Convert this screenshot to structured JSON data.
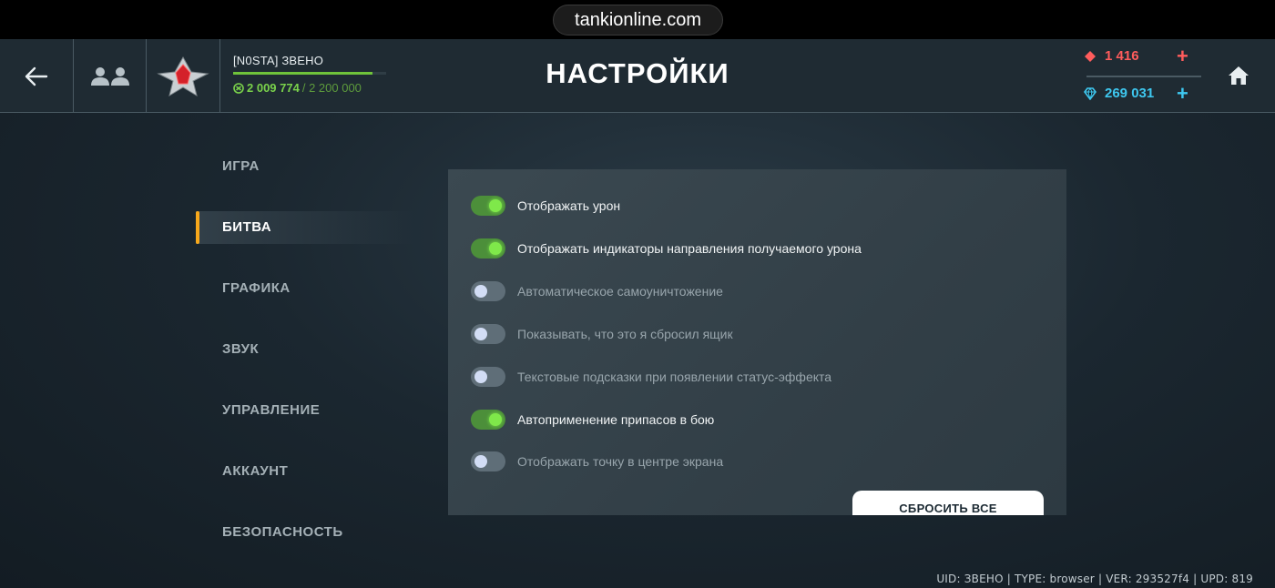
{
  "browser": {
    "url": "tankionline.com"
  },
  "header": {
    "title": "НАСТРОЙКИ",
    "player": {
      "name": "[N0STA] ЗВЕНО",
      "xp_current": "2 009 774",
      "xp_max": "/ 2 200 000",
      "xp_progress": 0.913
    },
    "currency": {
      "rubies": "1 416",
      "crystals": "269 031",
      "plus": "+"
    },
    "colors": {
      "accent": "#f7a81b",
      "xp": "#6fc33a",
      "ruby": "#ff5c5c",
      "crystal": "#3ec8f0"
    }
  },
  "sidebar": {
    "items": [
      {
        "label": "ИГРА",
        "active": false
      },
      {
        "label": "БИТВА",
        "active": true
      },
      {
        "label": "ГРАФИКА",
        "active": false
      },
      {
        "label": "ЗВУК",
        "active": false
      },
      {
        "label": "УПРАВЛЕНИЕ",
        "active": false
      },
      {
        "label": "АККАУНТ",
        "active": false
      },
      {
        "label": "БЕЗОПАСНОСТЬ",
        "active": false
      }
    ]
  },
  "settings": {
    "options": [
      {
        "label": "Отображать урон",
        "enabled": true
      },
      {
        "label": "Отображать индикаторы направления получаемого урона",
        "enabled": true
      },
      {
        "label": "Автоматическое самоуничтожение",
        "enabled": false
      },
      {
        "label": "Показывать, что это я сбросил ящик",
        "enabled": false
      },
      {
        "label": "Текстовые подсказки при появлении статус-эффекта",
        "enabled": false
      },
      {
        "label": "Автоприменение припасов в бою",
        "enabled": true
      },
      {
        "label": "Отображать точку в центре экрана",
        "enabled": false
      }
    ],
    "reset_label": "СБРОСИТЬ ВСЕ"
  },
  "footer": {
    "build_info": "UID: ЗВЕНО | TYPE: browser | VER: 293527f4 | UPD: 819"
  },
  "icons": {
    "back": "arrow-left-icon",
    "friends": "friends-icon",
    "rank": "rank-star-icon",
    "xp": "xp-icon",
    "ruby": "ruby-icon",
    "crystal": "crystal-icon",
    "home": "home-icon"
  }
}
